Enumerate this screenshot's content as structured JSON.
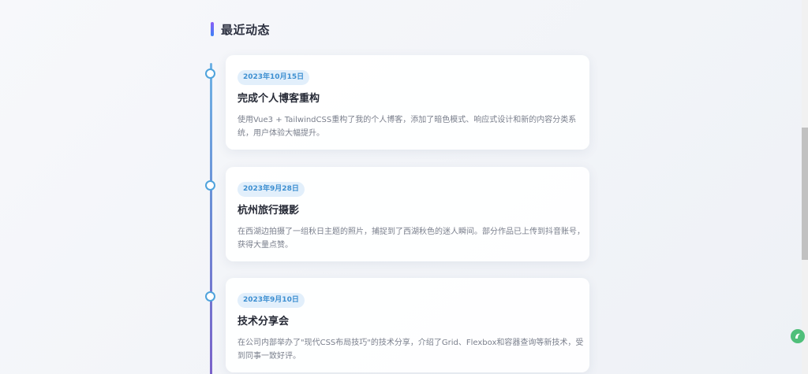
{
  "section": {
    "title": "最近动态"
  },
  "timeline": [
    {
      "date": "2023年10月15日",
      "title": "完成个人博客重构",
      "description": "使用Vue3 + TailwindCSS重构了我的个人博客，添加了暗色模式、响应式设计和新的内容分类系统，用户体验大幅提升。"
    },
    {
      "date": "2023年9月28日",
      "title": "杭州旅行摄影",
      "description": "在西湖边拍摄了一组秋日主题的照片，捕捉到了西湖秋色的迷人瞬间。部分作品已上传到抖音账号，获得大量点赞。"
    },
    {
      "date": "2023年9月10日",
      "title": "技术分享会",
      "description": "在公司内部举办了\"现代CSS布局技巧\"的技术分享，介绍了Grid、Flexbox和容器查询等新技术，受到同事一致好评。"
    }
  ],
  "colors": {
    "accent_blue": "#3d8fd1",
    "accent_purple": "#8b5cf6",
    "float_button": "#4fbf7a"
  },
  "icons": {
    "float_button": "assistant-icon"
  }
}
